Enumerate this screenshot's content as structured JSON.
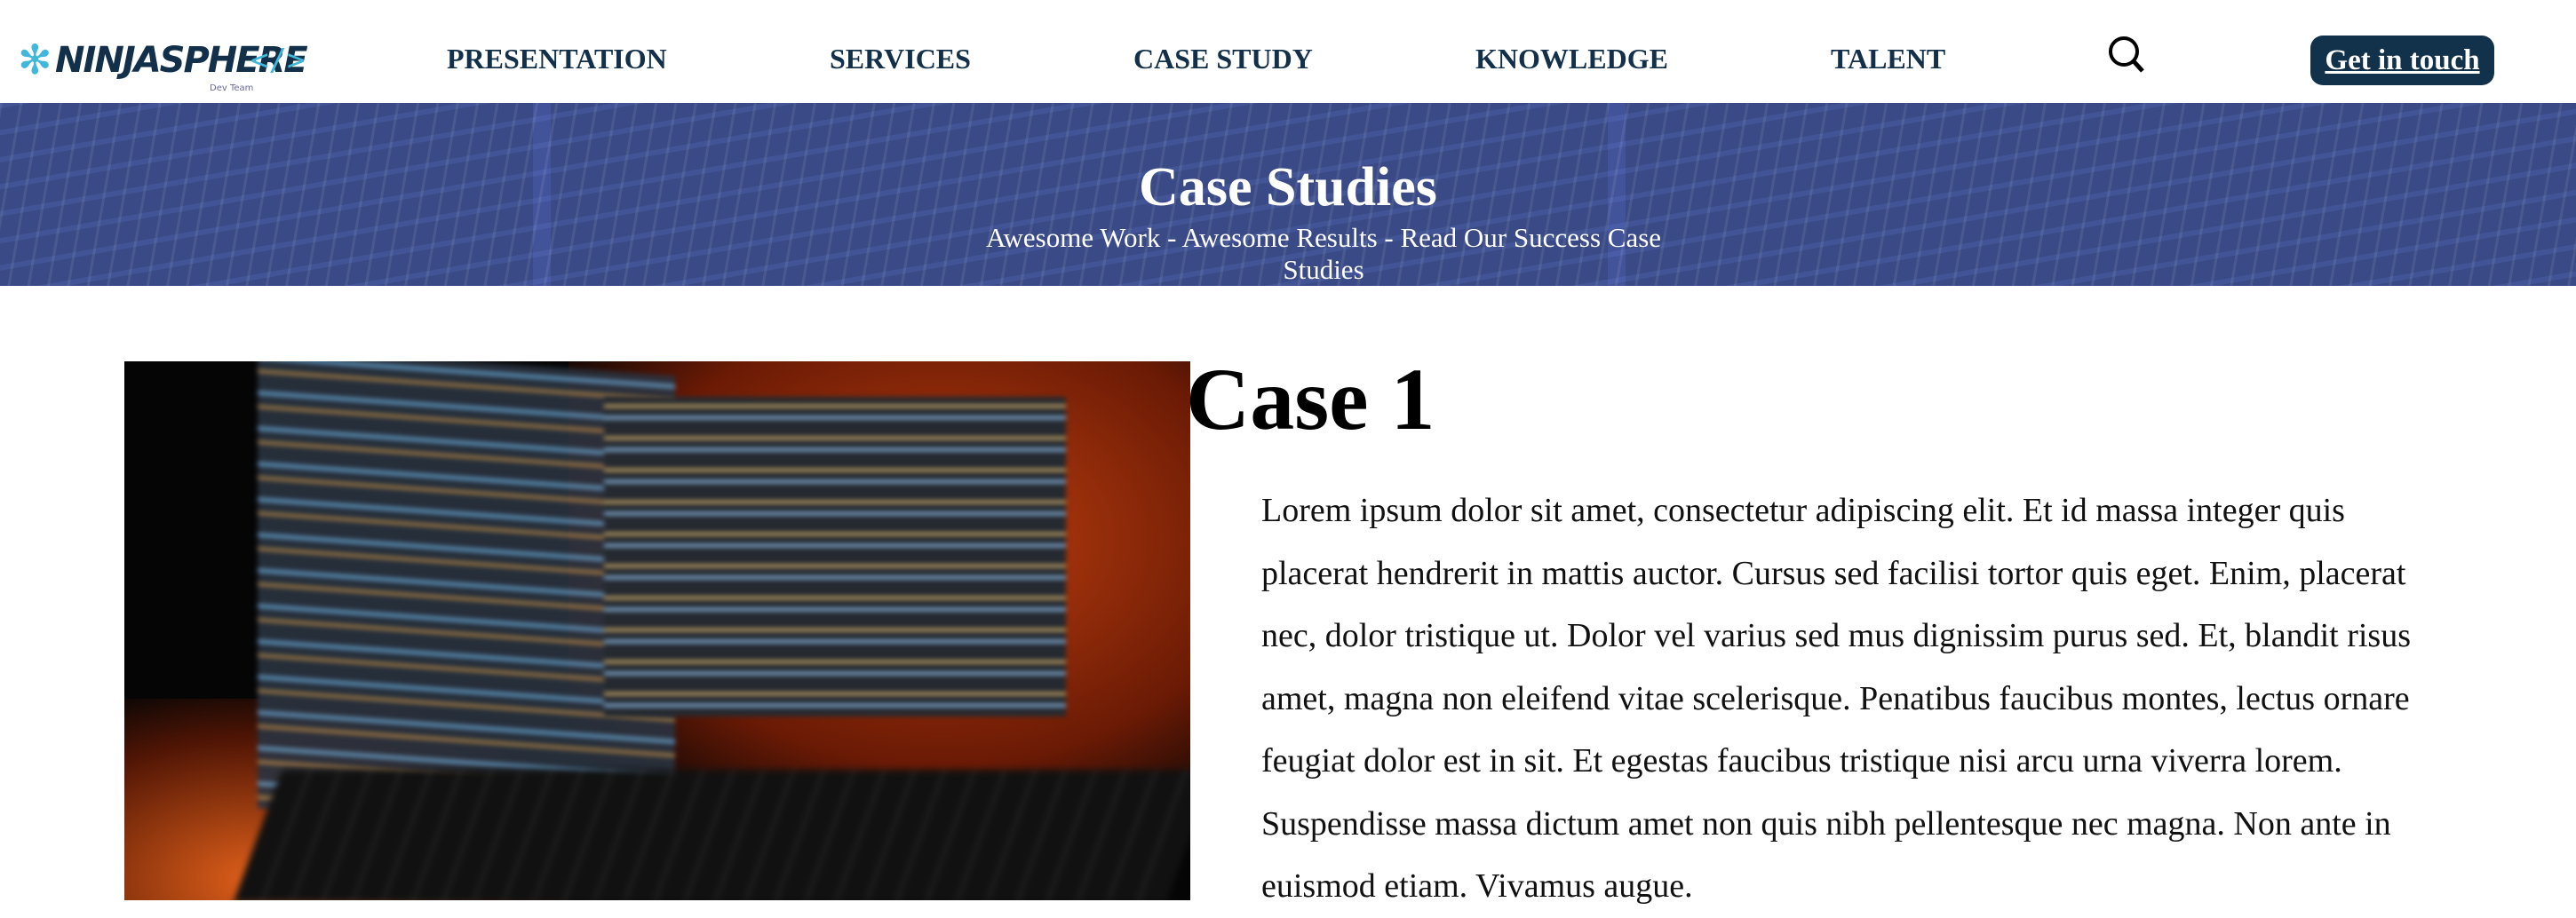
{
  "header": {
    "logo": {
      "text": "NINJASPHERE",
      "tagline": "Dev Team",
      "accent": "#3fb8dc"
    },
    "nav": [
      "PRESENTATION",
      "SERVICES",
      "CASE STUDY",
      "KNOWLEDGE",
      "TALENT"
    ],
    "search_icon": "search-icon",
    "cta_label": "Get in touch",
    "brand_color": "#12314a"
  },
  "banner": {
    "title": "Case Studies",
    "subtitle": "Awesome Work - Awesome Results - Read Our Success Case Studies"
  },
  "case": {
    "title": "Case 1",
    "body": "Lorem ipsum dolor sit amet, consectetur adipiscing elit. Et id massa integer quis placerat hendrerit in mattis auctor. Cursus sed facilisi tortor quis eget. Enim, placerat nec, dolor tristique ut. Dolor vel varius sed mus dignissim purus sed. Et, blandit risus amet, magna non eleifend vitae scelerisque. Penatibus faucibus montes, lectus ornare feugiat dolor est in sit. Et egestas faucibus tristique nisi arcu urna viverra lorem. Suspendisse massa dictum amet non quis nibh pellentesque nec magna. Non ante in euismod etiam. Vivamus augue."
  }
}
